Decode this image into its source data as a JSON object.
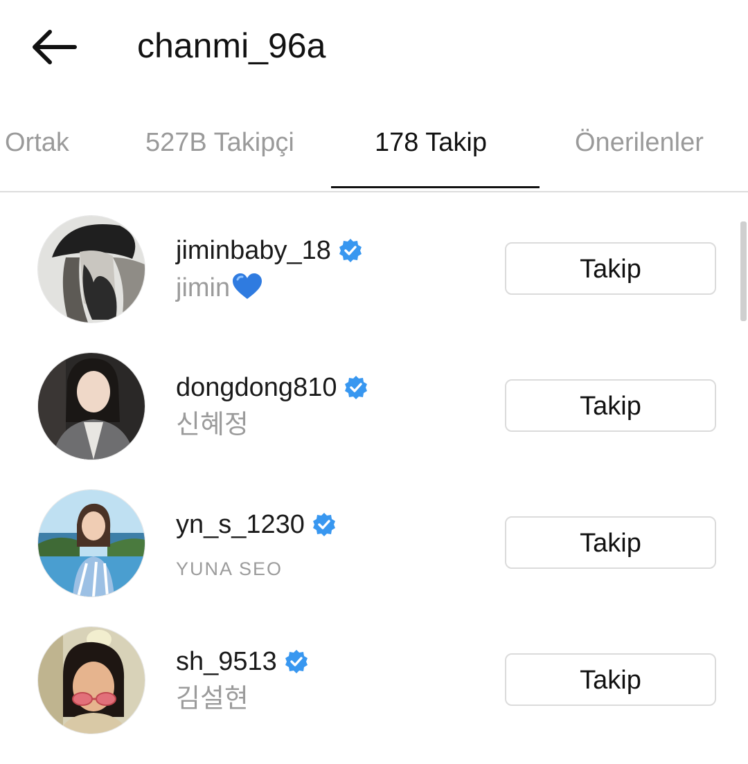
{
  "header": {
    "title": "chanmi_96a",
    "back_icon": "arrow-left-icon"
  },
  "tabs": [
    {
      "label": "Ortak",
      "active": false
    },
    {
      "label": "527B Takipçi",
      "active": false
    },
    {
      "label": "178 Takip",
      "active": true
    },
    {
      "label": "Önerilenler",
      "active": false
    }
  ],
  "accounts": [
    {
      "username": "jiminbaby_18",
      "verified": true,
      "full_name": "jimin",
      "full_name_icon": "blue-heart-emoji",
      "button": "Takip"
    },
    {
      "username": "dongdong810",
      "verified": true,
      "full_name": "신혜정",
      "button": "Takip"
    },
    {
      "username": "yn_s_1230",
      "verified": true,
      "full_name": "YUNA SEO",
      "button": "Takip"
    },
    {
      "username": "sh_9513",
      "verified": true,
      "full_name": "김설현",
      "button": "Takip"
    }
  ],
  "colors": {
    "verified_badge": "#3897f0",
    "secondary_text": "#9b9b9b",
    "button_border": "#dbdbdb",
    "heart": "#2f7be0"
  }
}
